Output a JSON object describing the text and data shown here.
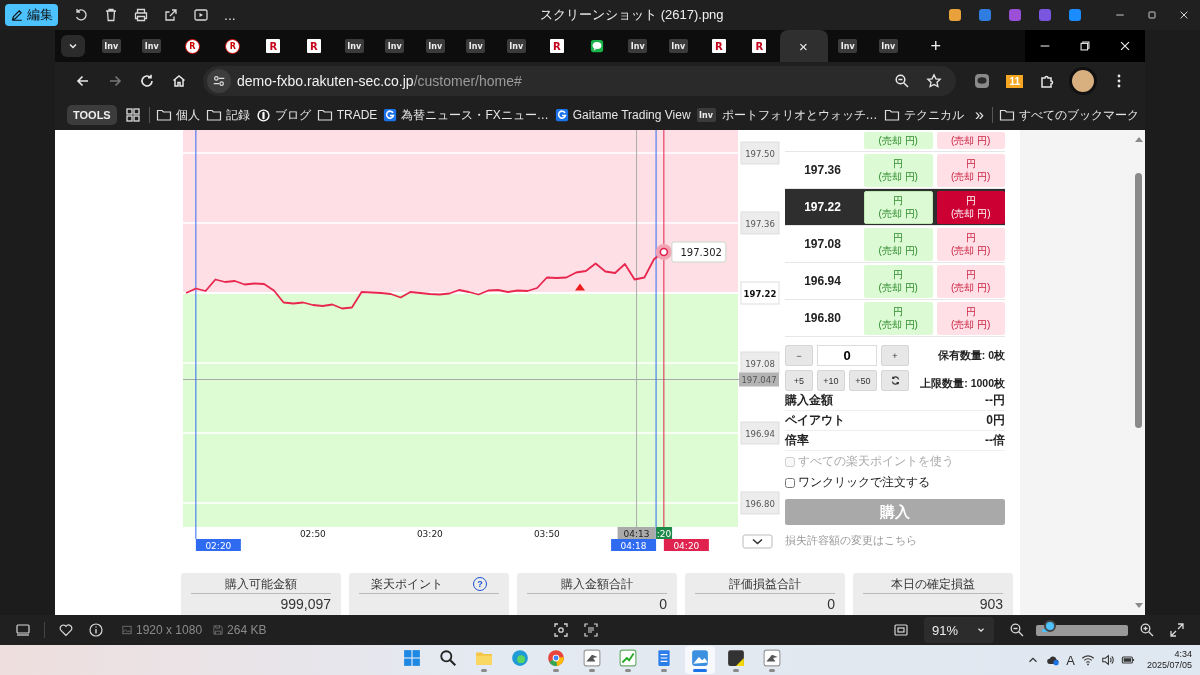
{
  "viewer": {
    "edit_button": "編集",
    "more": "...",
    "title": "スクリーンショット (2617).png",
    "dimensions": "1920 x 1080",
    "file_size": "264 KB",
    "zoom": "91%",
    "zoom_slider": {
      "level": 0.15
    }
  },
  "browser": {
    "tabs": [
      {
        "kind": "inv",
        "icon_text": "Inv",
        "selected": false
      },
      {
        "kind": "inv",
        "icon_text": "Inv",
        "selected": false
      },
      {
        "kind": "ring",
        "icon_text": "R",
        "selected": false
      },
      {
        "kind": "ring",
        "icon_text": "R",
        "selected": false
      },
      {
        "kind": "square",
        "icon_text": "R",
        "selected": false
      },
      {
        "kind": "square",
        "icon_text": "R",
        "selected": false
      },
      {
        "kind": "inv",
        "icon_text": "Inv",
        "selected": false
      },
      {
        "kind": "inv",
        "icon_text": "Inv",
        "selected": false
      },
      {
        "kind": "inv",
        "icon_text": "Inv",
        "selected": false
      },
      {
        "kind": "inv",
        "icon_text": "Inv",
        "selected": false
      },
      {
        "kind": "inv",
        "icon_text": "Inv",
        "selected": false
      },
      {
        "kind": "square",
        "icon_text": "R",
        "selected": false
      },
      {
        "kind": "chat",
        "selected": false
      },
      {
        "kind": "inv",
        "icon_text": "Inv",
        "selected": false
      },
      {
        "kind": "inv",
        "icon_text": "Inv",
        "selected": false
      },
      {
        "kind": "square",
        "icon_text": "R",
        "selected": false
      },
      {
        "kind": "square",
        "icon_text": "R",
        "selected": false
      },
      {
        "kind": "active",
        "close": "×",
        "selected": true
      },
      {
        "kind": "inv",
        "icon_text": "Inv",
        "selected": false
      },
      {
        "kind": "inv",
        "icon_text": "Inv",
        "selected": false
      }
    ],
    "new_tab": "+",
    "url_host": "demo-fxbo.rakuten-sec.co.jp",
    "url_path": "/customer/home#",
    "extension_badge": "11",
    "bookmarks": [
      {
        "kind": "tools",
        "label": "TOOLS"
      },
      {
        "kind": "apps"
      },
      {
        "kind": "folder",
        "label": "個人"
      },
      {
        "kind": "folder",
        "label": "記録"
      },
      {
        "kind": "blog",
        "label": "ブログ"
      },
      {
        "kind": "folder",
        "label": "TRADE"
      },
      {
        "kind": "globe",
        "label": "為替ニュース・FXニュー…"
      },
      {
        "kind": "globe",
        "label": "Gaitame Trading View"
      },
      {
        "kind": "inv",
        "icon_text": "Inv",
        "label": "ポートフォリオとウォッチ…"
      },
      {
        "kind": "folder",
        "label": "テクニカル"
      },
      {
        "kind": "more",
        "label": "»"
      },
      {
        "kind": "folder",
        "label": "すべてのブックマーク"
      }
    ]
  },
  "chart": {
    "chart_data": {
      "type": "line",
      "categories": [
        null,
        null,
        null,
        null,
        null,
        null,
        null,
        null,
        null,
        null,
        null,
        null,
        null,
        "02:50",
        null,
        null,
        null,
        null,
        null,
        null,
        null,
        null,
        null,
        null,
        null,
        "03:20",
        null,
        null,
        null,
        null,
        null,
        null,
        null,
        null,
        null,
        null,
        null,
        "03:50",
        null,
        null,
        null,
        null,
        null,
        null,
        null,
        null,
        null,
        null,
        null,
        null
      ],
      "series": [
        {
          "color": "#e8274f",
          "values": [
            197.22,
            197.229,
            197.224,
            197.247,
            197.242,
            197.244,
            197.237,
            197.239,
            197.238,
            197.225,
            197.201,
            197.199,
            197.201,
            197.196,
            197.194,
            197.197,
            197.189,
            197.191,
            197.222,
            197.221,
            197.22,
            197.218,
            197.211,
            197.222,
            197.22,
            197.218,
            197.217,
            197.219,
            197.226,
            197.222,
            197.217,
            197.225,
            197.226,
            197.222,
            197.225,
            197.224,
            197.23,
            197.251,
            197.25,
            197.251,
            197.261,
            197.264,
            197.279,
            197.263,
            197.26,
            197.278,
            197.247,
            197.251,
            197.288,
            197.302
          ]
        }
      ],
      "ylim": [
        196.752,
        197.546
      ],
      "grid": true,
      "yticks": [
        {
          "value": 197.5,
          "label": "197.50"
        },
        {
          "value": 197.36,
          "label": "197.36"
        },
        {
          "value": 197.22,
          "label": "197.22"
        },
        {
          "value": 197.08,
          "label": "197.08"
        },
        {
          "value": 196.94,
          "label": "196.94"
        },
        {
          "value": 196.8,
          "label": "196.80"
        }
      ],
      "ref_lines": [
        {
          "axis": "y",
          "value": 197.22
        },
        {
          "axis": "y",
          "value": 197.047,
          "label": "197.047"
        }
      ],
      "annotations": [
        "02:20",
        "04:13",
        ":20",
        "04:18",
        "04:20",
        "197.302"
      ]
    }
  },
  "ladder": {
    "rows": [
      {
        "kind": "partial",
        "up_sub": "(売却 円)",
        "down_sub": "(売却 円)",
        "selected": false
      },
      {
        "kind": "full",
        "price": "197.36",
        "up": "円",
        "up_sub": "(売却 円)",
        "down": "円",
        "down_sub": "(売却 円)",
        "selected": false
      },
      {
        "kind": "full",
        "price": "197.22",
        "up": "円",
        "up_sub": "(売却 円)",
        "down": "円",
        "down_sub": "(売却 円)",
        "selected": true
      },
      {
        "kind": "full",
        "price": "197.08",
        "up": "円",
        "up_sub": "(売却 円)",
        "down": "円",
        "down_sub": "(売却 円)",
        "selected": false
      },
      {
        "kind": "full",
        "price": "196.94",
        "up": "円",
        "up_sub": "(売却 円)",
        "down": "円",
        "down_sub": "(売却 円)",
        "selected": false
      },
      {
        "kind": "full",
        "price": "196.80",
        "up": "円",
        "up_sub": "(売却 円)",
        "down": "円",
        "down_sub": "(売却 円)",
        "selected": false
      }
    ]
  },
  "order": {
    "minus": "−",
    "quantity": "0",
    "plus": "+",
    "steps": [
      "+5",
      "+10",
      "+50"
    ],
    "held": "保有数量: 0枚",
    "limit": "上限数量: 1000枚",
    "details": [
      {
        "label": "購入金額",
        "value": "--円"
      },
      {
        "label": "ペイアウト",
        "value": "0円"
      },
      {
        "label": "倍率",
        "value": "--倍"
      }
    ],
    "options": [
      {
        "label": "すべての楽天ポイントを使う",
        "checked": false,
        "disabled": true
      },
      {
        "label": "ワンクリックで注文する",
        "checked": false,
        "disabled": false
      }
    ],
    "buy_button": {
      "label": "購入",
      "disabled": true
    },
    "link": "損失許容額の変更はこちら"
  },
  "summary": [
    {
      "label": "購入可能金額",
      "value": "999,097"
    },
    {
      "label": "楽天ポイント",
      "help": "?"
    },
    {
      "label": "購入金額合計",
      "value": "0"
    },
    {
      "label": "評価損益合計",
      "value": "0"
    },
    {
      "label": "本日の確定損益",
      "value": "903"
    }
  ],
  "taskbar": {
    "apps": [
      {
        "kind": "start",
        "running": false,
        "selected": false
      },
      {
        "kind": "search",
        "running": false,
        "selected": false
      },
      {
        "kind": "folder",
        "running": true,
        "selected": false
      },
      {
        "kind": "edge",
        "running": false,
        "selected": false
      },
      {
        "kind": "chrome",
        "running": true,
        "selected": false
      },
      {
        "kind": "app",
        "running": true,
        "selected": false
      },
      {
        "kind": "chart",
        "running": true,
        "selected": false
      },
      {
        "kind": "notes",
        "running": true,
        "selected": false
      },
      {
        "kind": "photos",
        "running": true,
        "selected": true
      },
      {
        "kind": "sticky",
        "running": true,
        "selected": false
      },
      {
        "kind": "app",
        "running": true,
        "selected": false
      }
    ],
    "ime": "A",
    "time": "4:34",
    "date": "2025/07/05"
  }
}
